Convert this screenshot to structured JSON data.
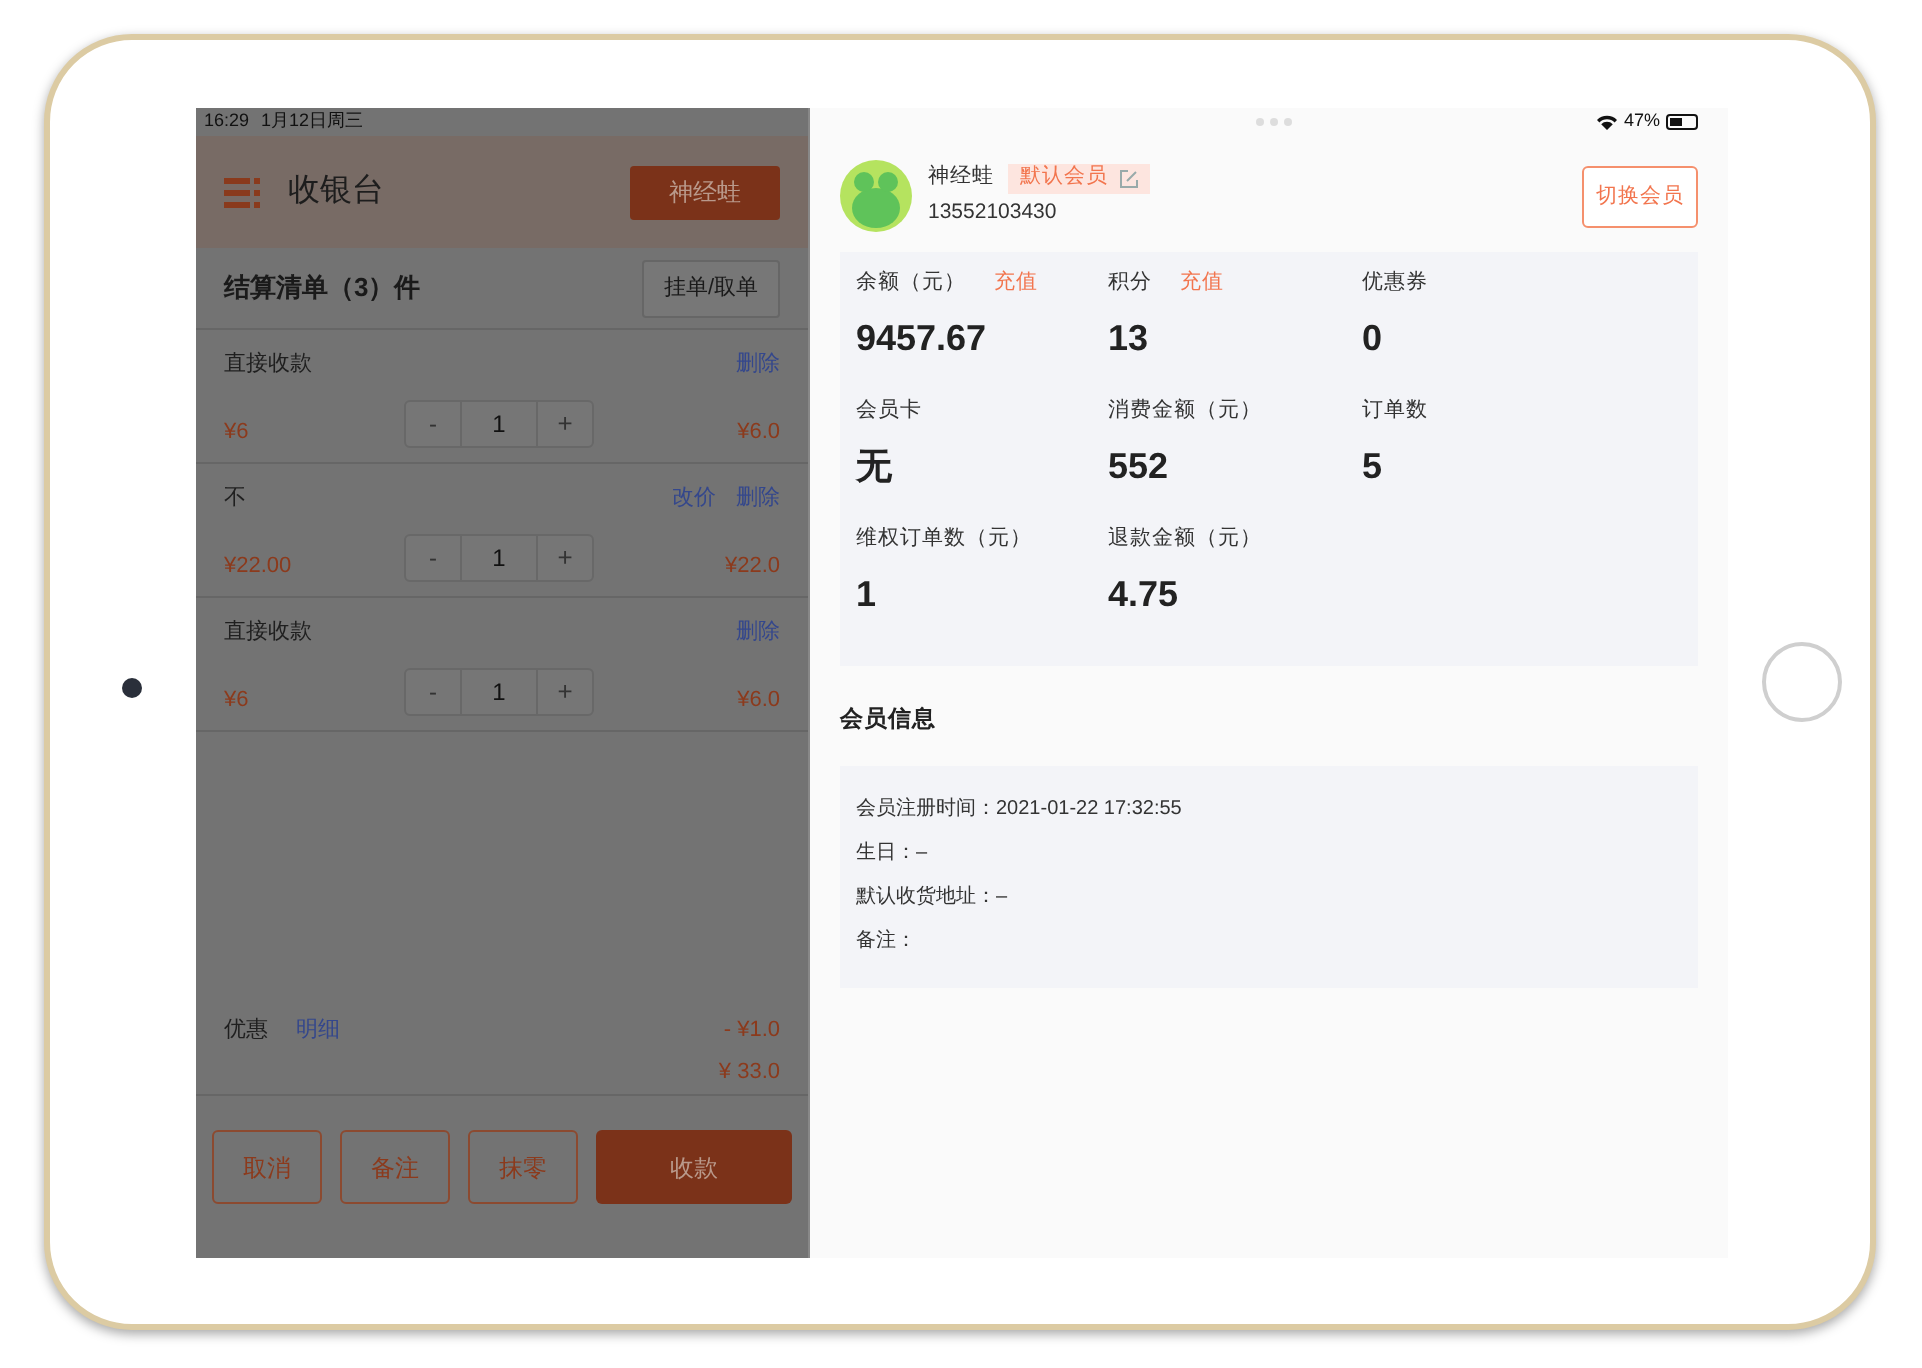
{
  "left_status_bar": {
    "time": "16:29",
    "date": "1月12日周三"
  },
  "right_status_bar": {
    "battery": "47%"
  },
  "cashier": {
    "title": "收银台",
    "member_button": "神经蛙",
    "cart_title": "结算清单（3）件",
    "hold_button": "挂单/取单",
    "items": [
      {
        "name": "直接收款",
        "actions": [
          "删除"
        ],
        "unit_price": "¥6",
        "decrease": "-",
        "quantity": "1",
        "increase": "+",
        "total": "¥6.0"
      },
      {
        "name": "不",
        "actions": [
          "改价",
          "删除"
        ],
        "unit_price": "¥22.00",
        "decrease": "-",
        "quantity": "1",
        "increase": "+",
        "total": "¥22.0"
      },
      {
        "name": "直接收款",
        "actions": [
          "删除"
        ],
        "unit_price": "¥6",
        "decrease": "-",
        "quantity": "1",
        "increase": "+",
        "total": "¥6.0"
      }
    ],
    "discount": {
      "label": "优惠",
      "link": "明细",
      "amount": "- ¥1.0"
    },
    "total": "¥ 33.0",
    "buttons": [
      {
        "label": "取消",
        "kind": "outline"
      },
      {
        "label": "备注",
        "kind": "outline"
      },
      {
        "label": "抹零",
        "kind": "outline"
      },
      {
        "label": "收款",
        "kind": "primary"
      }
    ]
  },
  "member": {
    "name": "神经蛙",
    "tag": "默认会员",
    "phone": "13552103430",
    "switch_button": "切换会员",
    "stats": [
      {
        "label": "余额（元）",
        "action": "充值",
        "value": "9457.67"
      },
      {
        "label": "积分",
        "action": "充值",
        "value": "13"
      },
      {
        "label": "优惠券",
        "value": "0"
      },
      {
        "label": "会员卡",
        "value": "无"
      },
      {
        "label": "消费金额（元）",
        "value": "552"
      },
      {
        "label": "订单数",
        "value": "5"
      },
      {
        "label": "维权订单数（元）",
        "value": "1"
      },
      {
        "label": "退款金额（元）",
        "value": "4.75"
      }
    ],
    "info_title": "会员信息",
    "info": [
      "会员注册时间：2021-01-22 17:32:55",
      "生日：–",
      "默认收货地址：–",
      "备注："
    ]
  }
}
